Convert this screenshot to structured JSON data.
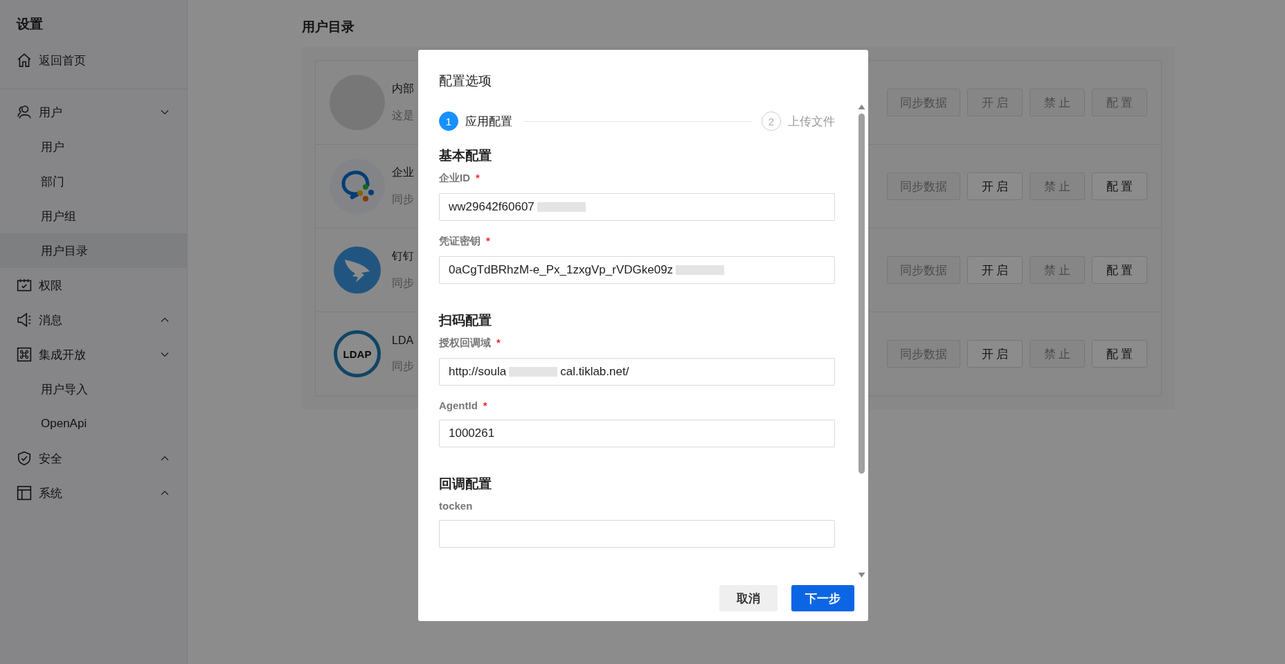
{
  "sidebar": {
    "title": "设置",
    "home": {
      "label": "返回首页"
    },
    "items": [
      {
        "label": "用户",
        "expanded": true,
        "children": [
          {
            "label": "用户",
            "selected": false
          },
          {
            "label": "部门",
            "selected": false
          },
          {
            "label": "用户组",
            "selected": false
          },
          {
            "label": "用户目录",
            "selected": true
          }
        ]
      },
      {
        "label": "权限"
      },
      {
        "label": "消息",
        "expanded": false
      },
      {
        "label": "集成开放",
        "expanded": true,
        "children": [
          {
            "label": "用户导入",
            "selected": false
          },
          {
            "label": "OpenApi",
            "selected": false
          }
        ]
      },
      {
        "label": "安全",
        "expanded": false
      },
      {
        "label": "系统",
        "expanded": false
      }
    ]
  },
  "page": {
    "title": "用户目录",
    "rows": [
      {
        "kind": "avatar",
        "name": "内部",
        "desc": "这是",
        "buttons": [
          {
            "label": "同步数据",
            "disabled": true
          },
          {
            "label": "开 启",
            "disabled": true
          },
          {
            "label": "禁 止",
            "disabled": true
          },
          {
            "label": "配 置",
            "disabled": true
          }
        ]
      },
      {
        "kind": "chat",
        "name": "企业",
        "desc": "同步",
        "buttons": [
          {
            "label": "同步数据",
            "disabled": true
          },
          {
            "label": "开 启",
            "disabled": false
          },
          {
            "label": "禁 止",
            "disabled": true
          },
          {
            "label": "配 置",
            "disabled": false
          }
        ]
      },
      {
        "kind": "wing",
        "name": "钉钉",
        "desc": "同步",
        "buttons": [
          {
            "label": "同步数据",
            "disabled": true
          },
          {
            "label": "开 启",
            "disabled": false
          },
          {
            "label": "禁 止",
            "disabled": true
          },
          {
            "label": "配 置",
            "disabled": false
          }
        ]
      },
      {
        "kind": "ldap",
        "logo_text": "LDAP",
        "name": "LDA",
        "desc": "同步",
        "buttons": [
          {
            "label": "同步数据",
            "disabled": true
          },
          {
            "label": "开 启",
            "disabled": false
          },
          {
            "label": "禁 止",
            "disabled": true
          },
          {
            "label": "配 置",
            "disabled": false
          }
        ]
      }
    ]
  },
  "dialog": {
    "title": "配置选项",
    "steps": [
      {
        "number": "1",
        "label": "应用配置",
        "selected": true
      },
      {
        "number": "2",
        "label": "上传文件",
        "selected": false
      }
    ],
    "sections": [
      {
        "title": "基本配置",
        "fields": [
          {
            "label": "企业ID",
            "required_mark": "*",
            "value": "ww29642f60607",
            "redacted": true
          },
          {
            "label": "凭证密钥",
            "required_mark": "*",
            "value": "0aCgTdBRhzM-e_Px_1zxgVp_rVDGke09z",
            "redacted": true
          }
        ]
      },
      {
        "title": "扫码配置",
        "fields": [
          {
            "label": "授权回调域",
            "required_mark": "*",
            "value": "http://soula",
            "value_end": "cal.tiklab.net/",
            "redacted": true
          },
          {
            "label": "AgentId",
            "required_mark": "*",
            "value": "1000261"
          }
        ]
      },
      {
        "title": "回调配置",
        "fields": [
          {
            "label": "tocken"
          }
        ]
      }
    ],
    "buttons": [
      {
        "label": "取消",
        "kind": "secondary"
      },
      {
        "label": "下一步",
        "kind": "primary"
      }
    ]
  }
}
